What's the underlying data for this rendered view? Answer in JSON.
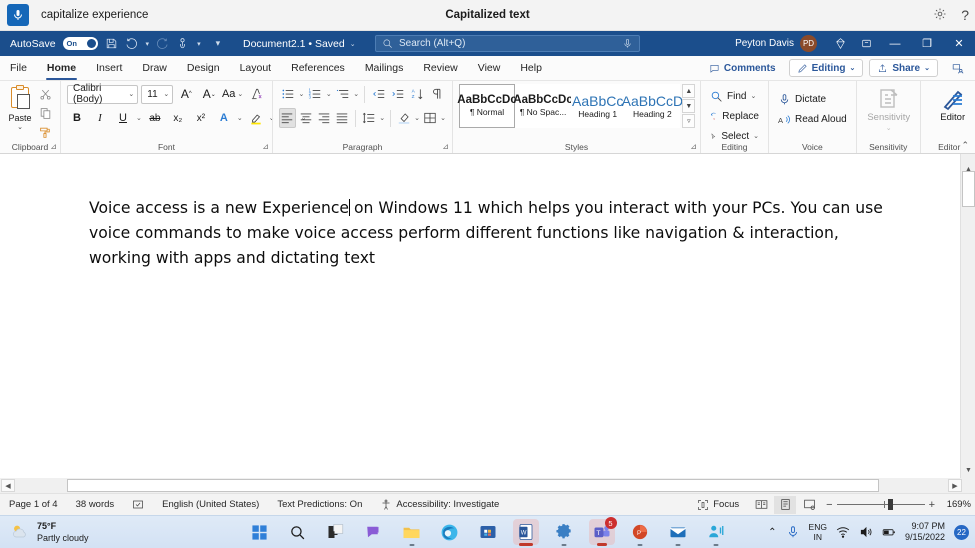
{
  "voice_access": {
    "mic_icon": "microphone-icon",
    "status_text": "capitalize experience",
    "title": "Capitalized text",
    "settings_icon": "gear-icon",
    "help_icon": "question-mark-icon"
  },
  "title_bar": {
    "autosave_label": "AutoSave",
    "autosave_state": "On",
    "save_icon": "save-icon",
    "undo_icon": "undo-icon",
    "redo_icon": "redo-icon",
    "touch_icon": "touch-mode-icon",
    "customize_icon": "customize-quick-access-icon",
    "document_name": "Document2.1  •  Saved",
    "search_placeholder": "Search (Alt+Q)",
    "search_icon": "search-icon",
    "search_mic_icon": "microphone-icon",
    "user_name": "Peyton Davis",
    "user_initials": "PD",
    "ribbon_display_icon": "diamond-icon",
    "restore_icon": "restore-down-icon",
    "minimize_label": "—",
    "maximize_label": "❐",
    "close_label": "✕",
    "accent": "#1b4e8c"
  },
  "tabs": [
    {
      "label": "File",
      "active": false
    },
    {
      "label": "Home",
      "active": true
    },
    {
      "label": "Insert",
      "active": false
    },
    {
      "label": "Draw",
      "active": false
    },
    {
      "label": "Design",
      "active": false
    },
    {
      "label": "Layout",
      "active": false
    },
    {
      "label": "References",
      "active": false
    },
    {
      "label": "Mailings",
      "active": false
    },
    {
      "label": "Review",
      "active": false
    },
    {
      "label": "View",
      "active": false
    },
    {
      "label": "Help",
      "active": false
    }
  ],
  "tabs_right": {
    "comments_label": "Comments",
    "comments_icon": "comment-icon",
    "editing_label": "Editing",
    "editing_icon": "pencil-icon",
    "share_label": "Share",
    "share_icon": "share-icon",
    "present_icon": "present-icon"
  },
  "ribbon": {
    "clipboard": {
      "label": "Clipboard",
      "paste_label": "Paste",
      "paste_icon": "paste-icon",
      "cut_icon": "scissors-icon",
      "copy_icon": "copy-icon",
      "format_painter_icon": "format-painter-icon",
      "launcher_icon": "dialog-launcher-icon"
    },
    "font": {
      "label": "Font",
      "font_name": "Calibri (Body)",
      "font_size": "11",
      "grow_font_icon": "grow-font-icon",
      "shrink_font_icon": "shrink-font-icon",
      "change_case_label": "Aa",
      "clear_formatting_icon": "clear-formatting-icon",
      "bold_label": "B",
      "italic_label": "I",
      "underline_label": "U",
      "strikethrough_label": "ab",
      "subscript_label": "x₂",
      "superscript_label": "x²",
      "text_effects_icon": "text-effects-icon",
      "highlight_icon": "highlight-color-icon",
      "highlight_color": "#ffe600",
      "font_color_icon": "font-color-icon",
      "font_color": "#cc0000",
      "launcher_icon": "dialog-launcher-icon"
    },
    "paragraph": {
      "label": "Paragraph",
      "bullets_icon": "bullet-list-icon",
      "numbering_icon": "numbered-list-icon",
      "multilevel_icon": "multilevel-list-icon",
      "decrease_indent_icon": "decrease-indent-icon",
      "increase_indent_icon": "increase-indent-icon",
      "sort_icon": "sort-az-icon",
      "show_marks_icon": "paragraph-mark-icon",
      "align_left_icon": "align-left-icon",
      "align_center_icon": "align-center-icon",
      "align_right_icon": "align-right-icon",
      "justify_icon": "justify-icon",
      "line_spacing_icon": "line-spacing-icon",
      "shading_icon": "shading-icon",
      "borders_icon": "borders-icon",
      "launcher_icon": "dialog-launcher-icon"
    },
    "styles": {
      "label": "Styles",
      "items": [
        {
          "preview": "AaBbCcDc",
          "name": "¶ Normal",
          "selected": true,
          "heading": false
        },
        {
          "preview": "AaBbCcDc",
          "name": "¶ No Spac...",
          "selected": false,
          "heading": false
        },
        {
          "preview": "AaBbCc",
          "name": "Heading 1",
          "selected": false,
          "heading": true
        },
        {
          "preview": "AaBbCcD",
          "name": "Heading 2",
          "selected": false,
          "heading": true
        }
      ],
      "scroll_up": "▲",
      "scroll_down": "▼",
      "more": "▿",
      "launcher_icon": "dialog-launcher-icon"
    },
    "editing": {
      "label": "Editing",
      "find_label": "Find",
      "find_icon": "find-icon",
      "replace_label": "Replace",
      "replace_icon": "replace-icon",
      "select_label": "Select",
      "select_icon": "select-cursor-icon"
    },
    "voice": {
      "label": "Voice",
      "dictate_label": "Dictate",
      "dictate_icon": "microphone-icon",
      "read_aloud_label": "Read Aloud",
      "read_aloud_icon": "read-aloud-icon"
    },
    "sensitivity": {
      "label": "Sensitivity",
      "button_label": "Sensitivity",
      "icon": "sensitivity-icon",
      "disabled": true
    },
    "editor": {
      "label": "Editor",
      "button_label": "Editor",
      "icon": "editor-pen-icon"
    },
    "collapse_icon": "collapse-ribbon-icon"
  },
  "document": {
    "line1_a": "Voice access is a new Experience",
    "line1_b": "on Windows 11 which helps you interact with your PCs. You can use",
    "line2": "voice commands to make voice access perform different functions like navigation & interaction, working",
    "line3": "with apps and dictating text"
  },
  "scrollbars": {
    "v_up": "▲",
    "v_down": "▼",
    "h_left": "◀",
    "h_right": "▶"
  },
  "status_bar": {
    "page_info": "Page 1 of 4",
    "word_count": "38 words",
    "proofing_icon": "proofing-errors-icon",
    "language": "English (United States)",
    "text_predictions": "Text Predictions: On",
    "accessibility_icon": "accessibility-icon",
    "accessibility": "Accessibility: Investigate",
    "focus_label": "Focus",
    "focus_icon": "focus-mode-icon",
    "read_mode_icon": "read-mode-icon",
    "print_layout_icon": "print-layout-icon",
    "web_layout_icon": "web-layout-icon",
    "zoom_out": "−",
    "zoom_in": "+",
    "zoom_value": "169%"
  },
  "taskbar": {
    "weather_temp": "75°F",
    "weather_desc": "Partly cloudy",
    "weather_icon": "partly-cloudy-icon",
    "apps": [
      {
        "name": "start-button",
        "icon": "windows-logo-icon"
      },
      {
        "name": "search-button",
        "icon": "search-icon"
      },
      {
        "name": "task-view-button",
        "icon": "task-view-icon"
      },
      {
        "name": "chat-button",
        "icon": "chat-icon"
      },
      {
        "name": "file-explorer-button",
        "icon": "folder-icon"
      },
      {
        "name": "edge-button",
        "icon": "edge-icon"
      },
      {
        "name": "microsoft-store-button",
        "icon": "store-icon"
      },
      {
        "name": "word-button",
        "icon": "word-icon"
      },
      {
        "name": "settings-button",
        "icon": "gear-icon"
      },
      {
        "name": "teams-button",
        "icon": "teams-icon",
        "badge": "5"
      },
      {
        "name": "powerpoint-button",
        "icon": "powerpoint-icon"
      },
      {
        "name": "mail-button",
        "icon": "mail-icon"
      },
      {
        "name": "voice-access-button",
        "icon": "voice-access-icon"
      }
    ],
    "tray": {
      "chevron": "⌃",
      "mic_icon": "microphone-icon",
      "lang_line1": "ENG",
      "lang_line2": "IN",
      "wifi_icon": "wifi-icon",
      "volume_icon": "speaker-icon",
      "battery_icon": "battery-icon",
      "time": "9:07 PM",
      "date": "9/15/2022",
      "notification_count": "22"
    }
  }
}
